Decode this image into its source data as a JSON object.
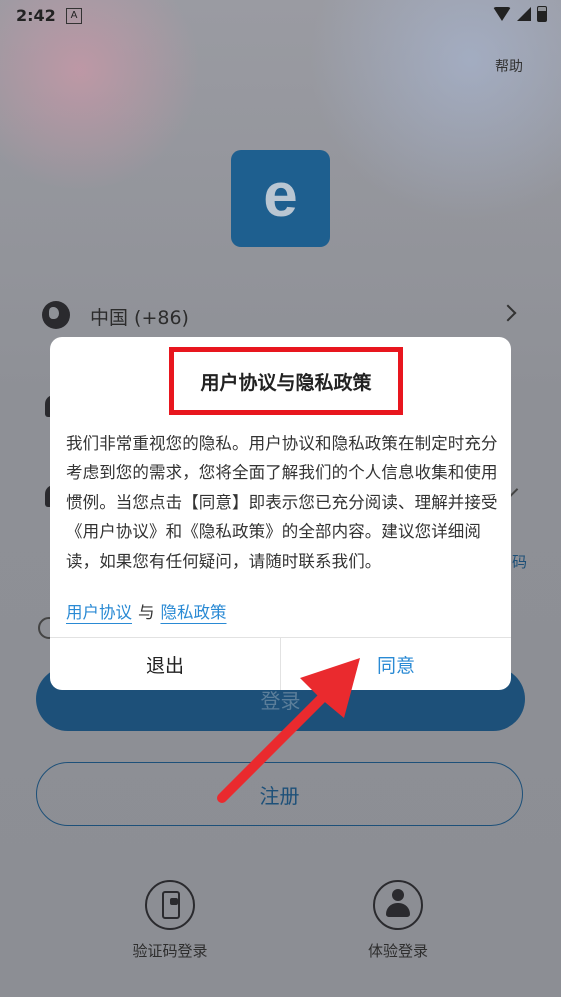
{
  "status_bar": {
    "time": "2:42",
    "notification_icon": "A"
  },
  "header": {
    "help_label": "帮助"
  },
  "app": {
    "logo_letter": "e"
  },
  "login_form": {
    "country_label": "中国 (+86)",
    "partial_text_right": "码",
    "login_label": "登录",
    "register_label": "注册"
  },
  "bottom_options": [
    {
      "label": "验证码登录",
      "icon": "phone-icon"
    },
    {
      "label": "体验登录",
      "icon": "person-icon"
    }
  ],
  "dialog": {
    "title": "用户协议与隐私政策",
    "body": "我们非常重视您的隐私。用户协议和隐私政策在制定时充分考虑到您的需求，您将全面了解我们的个人信息收集和使用惯例。当您点击【同意】即表示您已充分阅读、理解并接受《用户协议》和《隐私政策》的全部内容。建议您详细阅读，如果您有任何疑问，请随时联系我们。",
    "link_user_agreement": "用户协议",
    "link_separator": "与",
    "link_privacy_policy": "隐私政策",
    "exit_label": "退出",
    "agree_label": "同意"
  },
  "colors": {
    "accent_blue": "#2a8ad4",
    "highlight_red": "#e8161e",
    "overlay": "#8f9298"
  }
}
